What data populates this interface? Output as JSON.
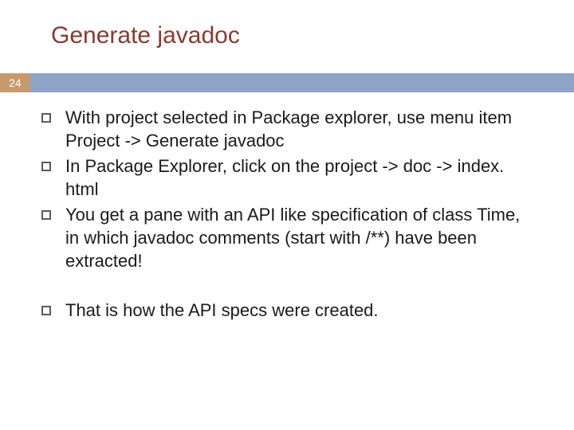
{
  "slide": {
    "title": "Generate javadoc",
    "page_number": "24",
    "bullets": [
      {
        "text": "With project selected in Package explorer, use menu item Project -> Generate javadoc"
      },
      {
        "text": "In Package Explorer, click on the project -> doc -> index. html"
      },
      {
        "text": "You get a pane with an API like specification of class Time, in which javadoc comments (start with /**) have been extracted!"
      },
      {
        "text": "That is how the API specs were created."
      }
    ]
  }
}
